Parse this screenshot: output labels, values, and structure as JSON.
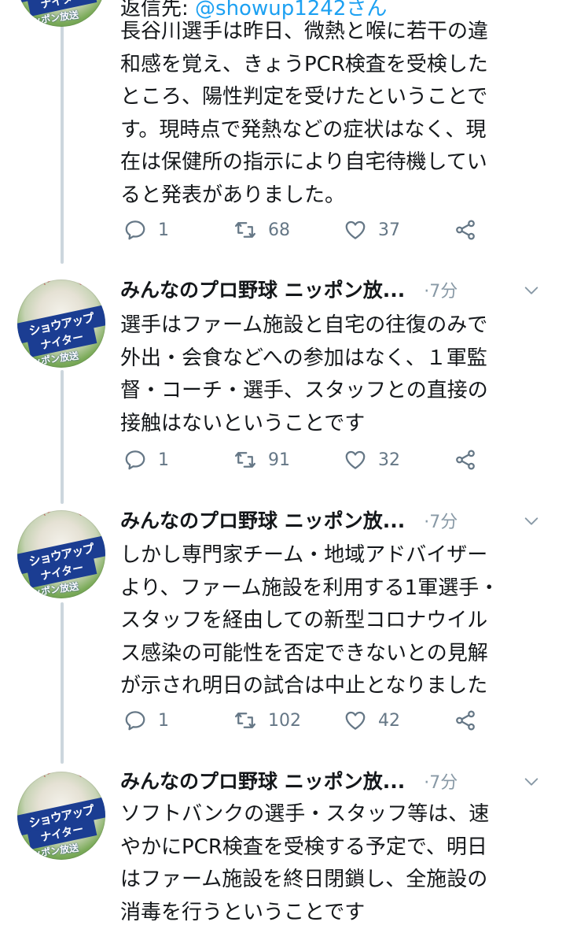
{
  "thread": {
    "reply_to_prefix": "返信先:",
    "reply_to_handle": "@showup1242さん",
    "tweets": [
      {
        "author": "",
        "time": "",
        "text_lines": [
          "長谷川選手は昨日、微熱と喉に若干の違",
          "和感を覚え、きょうPCR検査を受検した",
          "ところ、陽性判定を受けたということで",
          "す。現時点で発熱などの症状はなく、現",
          "在は保健所の指示により自宅待機してい",
          "ると発表がありました。"
        ],
        "replies": "1",
        "retweets": "68",
        "likes": "37"
      },
      {
        "author": "みんなのプロ野球 ニッポン放...",
        "separator": "·",
        "time": "7分",
        "text_lines": [
          "選手はファーム施設と自宅の往復のみで",
          "外出・会食などへの参加はなく、１軍監",
          "督・コーチ・選手、スタッフとの直接の",
          "接触はないということです"
        ],
        "replies": "1",
        "retweets": "91",
        "likes": "32"
      },
      {
        "author": "みんなのプロ野球 ニッポン放...",
        "separator": "·",
        "time": "7分",
        "text_lines": [
          "しかし専門家チーム・地域アドバイザー",
          "より、ファーム施設を利用する1軍選手・",
          "スタッフを経由しての新型コロナウイル",
          "ス感染の可能性を否定できないとの見解",
          "が示され明日の試合は中止となりました"
        ],
        "replies": "1",
        "retweets": "102",
        "likes": "42"
      },
      {
        "author": "みんなのプロ野球 ニッポン放...",
        "separator": "·",
        "time": "7分",
        "text_lines": [
          "ソフトバンクの選手・スタッフ等は、速",
          "やかにPCR検査を受検する予定で、明日",
          "はファーム施設を終日閉鎖し、全施設の",
          "消毒を行うということです"
        ]
      }
    ]
  },
  "avatar": {
    "line1": "ショウアップ",
    "line2": "ナイター",
    "line3": "ニッポン放送"
  },
  "colors": {
    "text": "#14171a",
    "meta": "#8899a6",
    "action": "#657786",
    "thread_line": "#ccd6dd",
    "link": "#1da1f2"
  },
  "icons": [
    "reply-icon",
    "retweet-icon",
    "like-icon",
    "share-icon",
    "chevron-down-icon"
  ]
}
